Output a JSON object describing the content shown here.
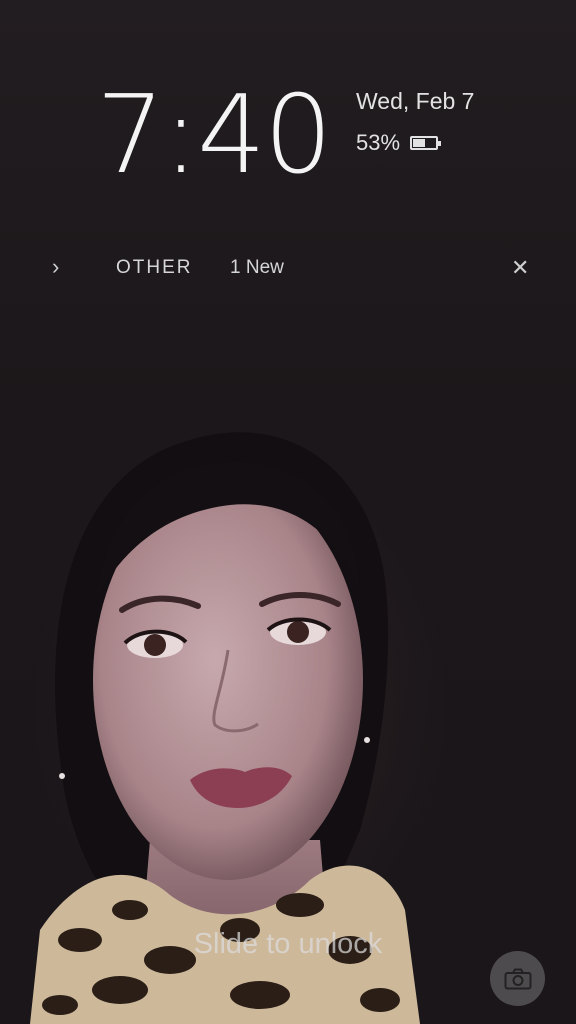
{
  "lockscreen": {
    "time": "7:40",
    "date": "Wed, Feb 7",
    "battery_percent": "53%",
    "battery_level": 0.53
  },
  "notification": {
    "category": "OTHER",
    "count": "1 New",
    "expand_icon": "chevron-right-icon",
    "dismiss_icon": "close-icon"
  },
  "unlock": {
    "hint": "Slide to unlock"
  },
  "shortcut": {
    "icon": "camera-icon"
  },
  "colors": {
    "text": "#f4f4f4",
    "background": "#1c181b"
  }
}
